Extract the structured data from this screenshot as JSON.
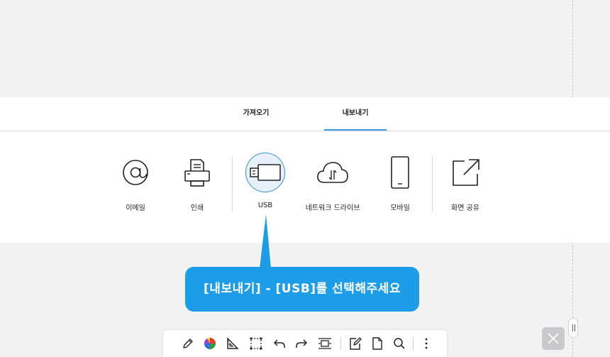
{
  "tabs": {
    "import_label": "가져오기",
    "export_label": "내보내기",
    "active": "export"
  },
  "export_options": {
    "email": {
      "label": "이메일",
      "icon": "at-sign-icon"
    },
    "print": {
      "label": "인쇄",
      "icon": "printer-icon"
    },
    "usb": {
      "label": "USB",
      "icon": "usb-drive-icon",
      "selected": true
    },
    "network_drive": {
      "label": "네트워크 드라이브",
      "icon": "cloud-upload-icon"
    },
    "mobile": {
      "label": "모바일",
      "icon": "smartphone-icon"
    },
    "screen_share": {
      "label": "화면 공유",
      "icon": "share-out-icon"
    }
  },
  "callout": {
    "text": "[내보내기] - [USB]를 선택해주세요"
  },
  "toolbar": {
    "icons": [
      "pen-icon",
      "color-wheel-icon",
      "ruler-icon",
      "select-icon",
      "undo-icon",
      "redo-icon",
      "fit-width-icon",
      "edit-page-icon",
      "page-icon",
      "search-icon",
      "more-icon"
    ]
  },
  "colors": {
    "accent": "#3a9be8",
    "callout_bg": "#1d9de8",
    "background": "#f2f2f3",
    "close_button_bg": "#c9c9cb"
  }
}
